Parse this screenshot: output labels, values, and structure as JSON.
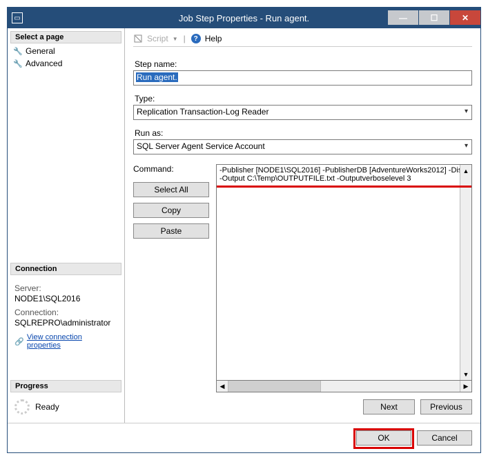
{
  "window": {
    "title": "Job Step Properties - Run agent."
  },
  "sidebar": {
    "select_page_header": "Select a page",
    "items": [
      {
        "label": "General"
      },
      {
        "label": "Advanced"
      }
    ],
    "connection_header": "Connection",
    "server_label": "Server:",
    "server_value": "NODE1\\SQL2016",
    "connection_label": "Connection:",
    "connection_value": "SQLREPRO\\administrator",
    "view_connection_link": "View connection properties",
    "progress_header": "Progress",
    "progress_status": "Ready"
  },
  "toolbar": {
    "script_label": "Script",
    "help_label": "Help"
  },
  "form": {
    "step_name_label": "Step name:",
    "step_name_value": "Run agent.",
    "type_label": "Type:",
    "type_value": "Replication Transaction-Log Reader",
    "run_as_label": "Run as:",
    "run_as_value": "SQL Server Agent Service Account",
    "command_label": "Command:",
    "command_text": "-Publisher [NODE1\\SQL2016] -PublisherDB [AdventureWorks2012] -Dis\n-Output C:\\Temp\\OUTPUTFILE.txt -Outputverboselevel 3",
    "select_all_btn": "Select All",
    "copy_btn": "Copy",
    "paste_btn": "Paste",
    "next_btn": "Next",
    "previous_btn": "Previous"
  },
  "buttons": {
    "ok": "OK",
    "cancel": "Cancel"
  }
}
